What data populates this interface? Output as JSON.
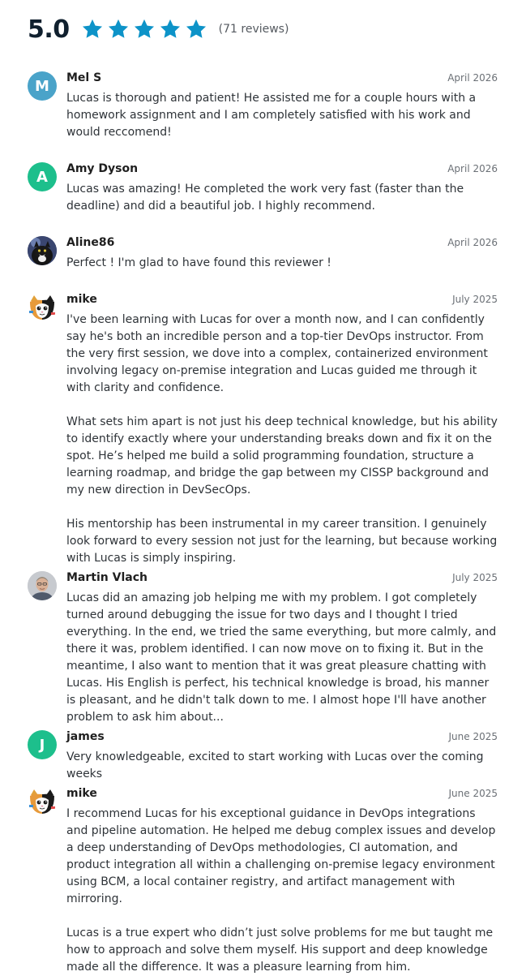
{
  "summary": {
    "rating": "5.0",
    "star_count": 5,
    "reviews_label": "(71 reviews)",
    "star_color": "#0d93c8"
  },
  "reviews": [
    {
      "initial": "M",
      "avatar_color": "#4aa3c9",
      "name": "Mel S",
      "date": "April 2026",
      "paragraphs": [
        "Lucas is thorough and patient! He assisted me for a couple hours with a homework assignment and I am completely satisfied with his work and would reccomend!"
      ]
    },
    {
      "initial": "A",
      "avatar_color": "#1dbf8c",
      "name": "Amy Dyson",
      "date": "April 2026",
      "paragraphs": [
        "Lucas was amazing! He completed the work very fast (faster than the deadline) and did a beautiful job. I highly recommend."
      ]
    },
    {
      "initial": "",
      "avatar_icon": "cat-photo-avatar",
      "name": "Aline86",
      "date": "April 2026",
      "paragraphs": [
        "Perfect ! I'm glad to have found this reviewer !"
      ]
    },
    {
      "initial": "",
      "avatar_icon": "cartoon-cat-avatar",
      "name": "mike",
      "date": "July 2025",
      "paragraphs": [
        "I've been learning with Lucas for over a month now, and I can confidently say he's both an incredible person and a top-tier DevOps instructor. From the very first session, we dove into a complex, containerized environment involving legacy on-premise integration and Lucas guided me through it with clarity and confidence.",
        "What sets him apart is not just his deep technical knowledge, but his ability to identify exactly where your understanding breaks down and fix it on the spot. He’s helped me build a solid programming foundation, structure a learning roadmap, and bridge the gap between my CISSP background and my new direction in DevSecOps.",
        "His mentorship has been instrumental in my career transition. I genuinely look forward to every session not just for the learning, but because working with Lucas is simply inspiring."
      ]
    },
    {
      "initial": "",
      "avatar_icon": "person-photo-avatar",
      "name": "Martin Vlach",
      "date": "July 2025",
      "paragraphs": [
        "Lucas did an amazing job helping me with my problem. I got completely turned around debugging the issue for two days and I thought I tried everything. In the end, we tried the same everything, but more calmly, and there it was, problem identified. I can now move on to fixing it. But in the meantime, I also want to mention that it was great pleasure chatting with Lucas. His English is perfect, his technical knowledge is broad, his manner is pleasant, and he didn't talk down to me. I almost hope I'll have another problem to ask him about..."
      ]
    },
    {
      "initial": "J",
      "avatar_color": "#1dbf8c",
      "name": "james",
      "date": "June 2025",
      "paragraphs": [
        "Very knowledgeable, excited to start working with Lucas over the coming weeks"
      ]
    },
    {
      "initial": "",
      "avatar_icon": "cartoon-cat-avatar",
      "name": "mike",
      "date": "June 2025",
      "paragraphs": [
        "I recommend Lucas for his exceptional guidance in DevOps integrations and pipeline automation. He helped me debug complex issues and develop a deep understanding of DevOps methodologies, CI automation, and product integration all within a challenging on-premise legacy environment using BCM, a local container registry, and artifact management with mirroring.",
        "Lucas is a true expert who didn’t just solve problems for me but taught me how to approach and solve them myself. His support and deep knowledge made all the difference. It was a pleasure learning from him."
      ]
    }
  ]
}
